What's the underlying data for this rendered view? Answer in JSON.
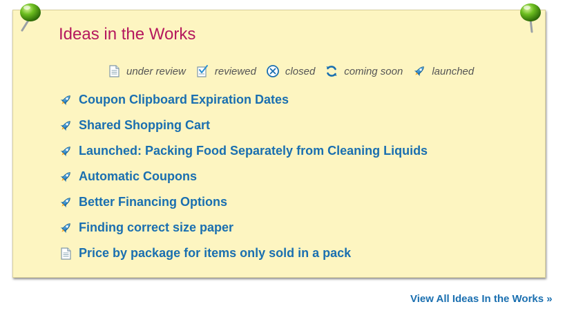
{
  "panel": {
    "title": "Ideas in the Works"
  },
  "legend": [
    {
      "icon": "under-review-icon",
      "label": "under review"
    },
    {
      "icon": "reviewed-icon",
      "label": "reviewed"
    },
    {
      "icon": "closed-icon",
      "label": "closed"
    },
    {
      "icon": "coming-soon-icon",
      "label": "coming soon"
    },
    {
      "icon": "launched-icon",
      "label": "launched"
    }
  ],
  "ideas": [
    {
      "status": "launched",
      "icon": "launched-icon",
      "title": "Coupon Clipboard Expiration Dates"
    },
    {
      "status": "launched",
      "icon": "launched-icon",
      "title": "Shared Shopping Cart"
    },
    {
      "status": "launched",
      "icon": "launched-icon",
      "title": "Launched: Packing Food Separately from Cleaning Liquids"
    },
    {
      "status": "launched",
      "icon": "launched-icon",
      "title": "Automatic Coupons"
    },
    {
      "status": "launched",
      "icon": "launched-icon",
      "title": "Better Financing Options"
    },
    {
      "status": "launched",
      "icon": "launched-icon",
      "title": "Finding correct size paper"
    },
    {
      "status": "under review",
      "icon": "under-review-icon",
      "title": "Price by package for items only sold in a pack"
    }
  ],
  "footer": {
    "view_all_label": "View All Ideas In the Works »"
  },
  "colors": {
    "note_background": "#fdf5c1",
    "title": "#b5185e",
    "link": "#1a6fb0",
    "legend_text": "#555555",
    "pin": "#5aa31a"
  }
}
